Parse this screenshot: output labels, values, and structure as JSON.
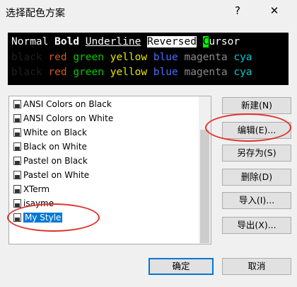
{
  "window": {
    "title": "选择配色方案",
    "help_glyph": "?",
    "close_glyph": "✕"
  },
  "colors": {
    "background": "#f0f0f0",
    "preview_bg": "#000000",
    "black": "#1e1e1e",
    "red": "#d05a1c",
    "green": "#00cd00",
    "yellow": "#e5e500",
    "blue": "#4a6cff",
    "magenta": "#8a8a8a",
    "cyan": "#00cdcd",
    "selection": "#0078d7",
    "annotation": "#e0322b"
  },
  "preview": {
    "styles_row": {
      "normal": "Normal",
      "bold": "Bold",
      "underline": "Underline",
      "reversed": "Reversed",
      "cursor_char": "C",
      "cursor_rest": "ursor"
    },
    "color_row_1": [
      "black",
      "red",
      "green",
      "yellow",
      "blue",
      "magenta",
      "cya"
    ],
    "color_row_2": [
      "black",
      "red",
      "green",
      "yellow",
      "blue",
      "magenta",
      "cya"
    ]
  },
  "schemes": {
    "items": [
      {
        "label": "ANSI Colors on Black"
      },
      {
        "label": "ANSI Colors on White"
      },
      {
        "label": "White on Black"
      },
      {
        "label": "Black on White"
      },
      {
        "label": "Pastel on Black"
      },
      {
        "label": "Pastel on White"
      },
      {
        "label": "XTerm"
      },
      {
        "label": "isayme"
      },
      {
        "label": "My Style"
      }
    ],
    "selected": "My Style"
  },
  "buttons": {
    "new": "新建(N)",
    "edit": "编辑(E)...",
    "save_as": "另存为(S)",
    "delete": "删除(D)",
    "import": "导入(I)...",
    "export": "导出(X)...",
    "ok": "确定",
    "cancel": "取消"
  }
}
